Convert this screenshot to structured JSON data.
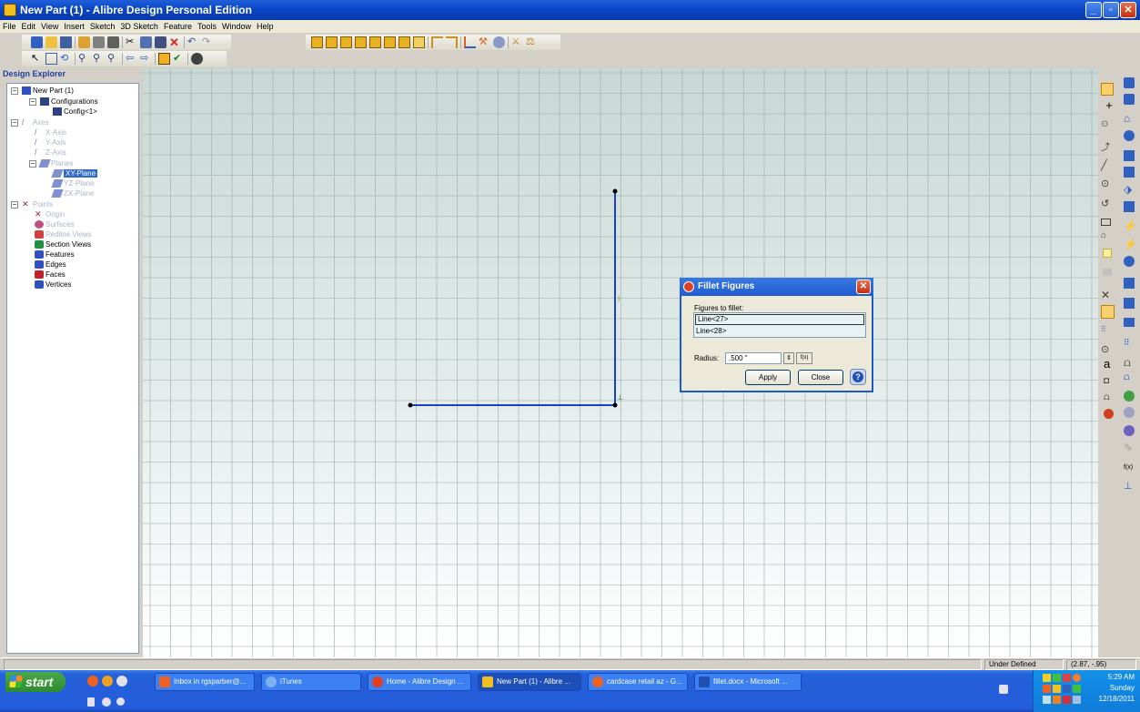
{
  "window": {
    "title": "New Part (1) - Alibre Design Personal Edition",
    "minimize": "_",
    "maximize": "▫",
    "close": "✕"
  },
  "menu": [
    "File",
    "Edit",
    "View",
    "Insert",
    "Sketch",
    "3D Sketch",
    "Feature",
    "Tools",
    "Window",
    "Help"
  ],
  "explorer": {
    "header": "Design Explorer",
    "items": {
      "root": "New Part (1)",
      "configurations": "Configurations",
      "config1": "Config<1>",
      "axes": "Axes",
      "xaxis": "X-Axis",
      "yaxis": "Y-Axis",
      "zaxis": "Z-Axis",
      "planes": "Planes",
      "xyplane": "XY-Plane",
      "yzplane": "YZ-Plane",
      "zxplane": "ZX-Plane",
      "points": "Points",
      "origin": "Origin",
      "surfaces": "Surfaces",
      "redline": "Redline Views",
      "section": "Section Views",
      "features": "Features",
      "edges": "Edges",
      "faces": "Faces",
      "vertices": "Vertices"
    }
  },
  "dialog": {
    "title": "Fillet Figures",
    "figures_label": "Figures to fillet:",
    "figures": [
      "Line<27>",
      "Line<28>"
    ],
    "radius_label": "Radius:",
    "radius_value": ".500 \"",
    "fx_label": "f(x)",
    "apply": "Apply",
    "close": "Close",
    "help": "?"
  },
  "sketch": {
    "constraint_vertical": "I",
    "constraint_perp": "⊥",
    "line_color": "#1a3fc8"
  },
  "right_toolbar": {
    "fx_label": "f(x)",
    "text_tool": "a"
  },
  "status": {
    "state": "Under Defined",
    "coords": "(2.87, -.95)"
  },
  "taskbar": {
    "start": "start",
    "tasks": [
      "Inbox in rgsparber@...",
      "iTunes",
      "Home - Alibre Design ...",
      "New Part (1) - Alibre ...",
      "cardcase retail az - G...",
      "fillet.docx - Microsoft ..."
    ],
    "clock_time": "5:29 AM",
    "clock_day": "Sunday",
    "clock_date": "12/18/2011"
  }
}
